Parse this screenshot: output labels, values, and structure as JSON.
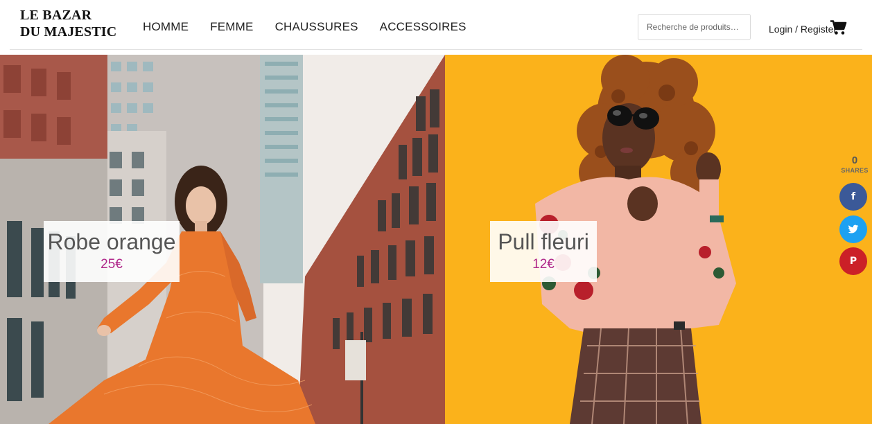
{
  "header": {
    "logo_line1": "LE BAZAR",
    "logo_line2": "DU MAJESTIC",
    "nav": [
      "HOMME",
      "FEMME",
      "CHAUSSURES",
      "ACCESSOIRES"
    ],
    "search_placeholder": "Recherche de produits…",
    "login_label": "Login / Register",
    "cart_icon": "shopping-cart-icon"
  },
  "products": [
    {
      "title": "Robe orange",
      "price": "25€"
    },
    {
      "title": "Pull fleuri",
      "price": "12€"
    }
  ],
  "share": {
    "count": "0",
    "label": "SHARES",
    "buttons": [
      {
        "network": "facebook",
        "glyph": "f",
        "color": "#3b5998"
      },
      {
        "network": "twitter",
        "glyph": "🐦",
        "color": "#1da1f2"
      },
      {
        "network": "pinterest",
        "glyph": "P",
        "color": "#cb2027"
      }
    ]
  },
  "colors": {
    "price": "#b0278a",
    "right_background": "#fbb21b",
    "dress": "#e9772d"
  }
}
